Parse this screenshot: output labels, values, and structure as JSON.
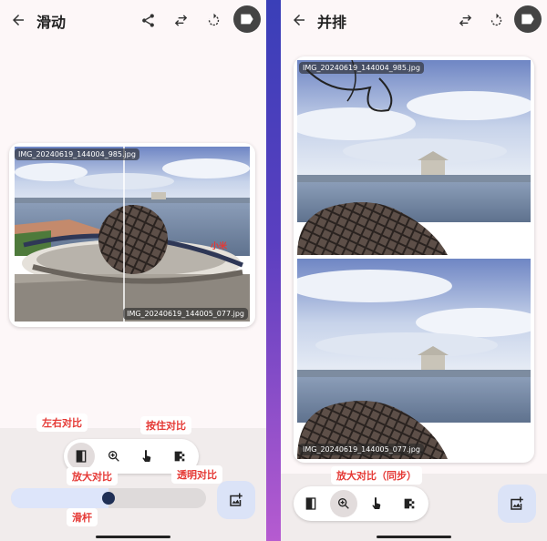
{
  "left_screen": {
    "title": "滑动",
    "image_top_filename": "IMG_20240619_144004_985.jpg",
    "image_bottom_filename": "IMG_20240619_144005_077.jpg",
    "watermark_text": "小米",
    "slider_value_fraction": 0.5,
    "toolbar_active": "side-by-side-compare",
    "annotations": {
      "side_compare": "左右对比",
      "hold_compare": "按住对比",
      "zoom_compare": "放大对比",
      "transparent_compare": "透明对比",
      "slider": "滑杆"
    }
  },
  "right_screen": {
    "title": "并排",
    "image_top_filename": "IMG_20240619_144004_985.jpg",
    "image_bottom_filename": "IMG_20240619_144005_077.jpg",
    "toolbar_active": "zoom-compare",
    "annotations": {
      "zoom_sync": "放大对比（同步）"
    }
  },
  "icons": {
    "back": "arrow-left-icon",
    "share": "share-icon",
    "swap": "swap-icon",
    "rotate": "rotate-icon",
    "label": "label-icon",
    "compare": "compare-icon",
    "zoom": "zoom-in-icon",
    "hold": "touch-icon",
    "transparent": "transparency-icon",
    "add_image": "add-photo-icon"
  },
  "colors": {
    "accent_red": "#e53935",
    "fab": "#dbe3f7",
    "slider_fill": "#dde5fa",
    "slider_thumb": "#1f2f55"
  }
}
